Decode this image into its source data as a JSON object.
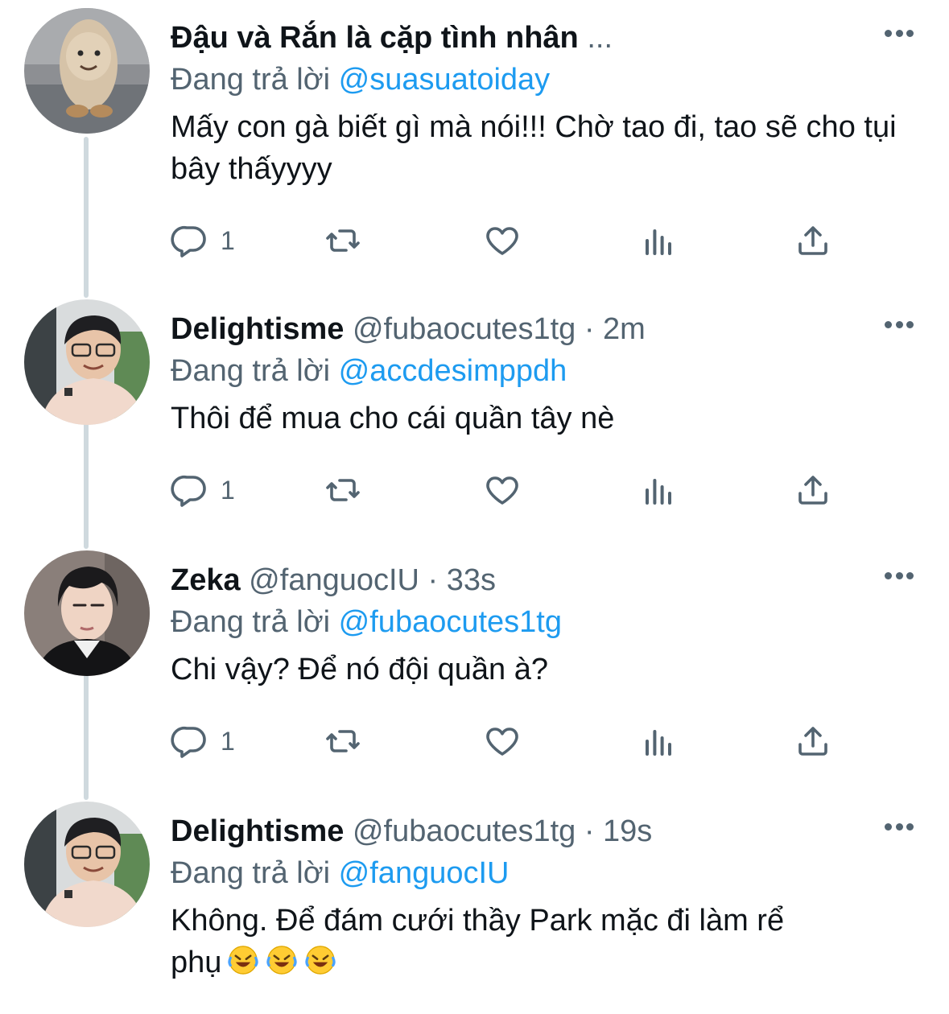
{
  "colors": {
    "link": "#1d9bf0",
    "secondary": "#536471",
    "primary": "#0f1419",
    "thread_line": "#cfd9de"
  },
  "tweets": [
    {
      "name": "Đậu và Rắn là cặp tình nhân",
      "handle_time": " ...",
      "reply_prefix": "Đang trả lời ",
      "reply_to": "@suasuatoiday",
      "text": "Mấy con gà biết gì mà nói!!! Chờ tao đi, tao sẽ cho tụi bây thấyyyy",
      "reply_count": "1",
      "avatar_icon": "plush-toy-avatar"
    },
    {
      "name": "Delightisme",
      "handle_time": " @fubaocutes1tg · 2m",
      "reply_prefix": "Đang trả lời ",
      "reply_to": "@accdesimppdh",
      "text": "Thôi để mua cho cái quần tây nè",
      "reply_count": "1",
      "avatar_icon": "person-glasses-avatar"
    },
    {
      "name": "Zeka",
      "handle_time": " @fanguocIU · 33s",
      "reply_prefix": "Đang trả lời ",
      "reply_to": "@fubaocutes1tg",
      "text": "Chi vậy? Để nó đội quần à?",
      "reply_count": "1",
      "avatar_icon": "person-avatar"
    },
    {
      "name": "Delightisme",
      "handle_time": " @fubaocutes1tg · 19s",
      "reply_prefix": "Đang trả lời ",
      "reply_to": "@fanguocIU",
      "text_line1": "Không. Để đám cưới thầy Park mặc đi làm rể",
      "text_line2": "phụ",
      "emoji": "rolling-on-floor-laughing-emoji",
      "avatar_icon": "person-glasses-avatar"
    }
  ]
}
